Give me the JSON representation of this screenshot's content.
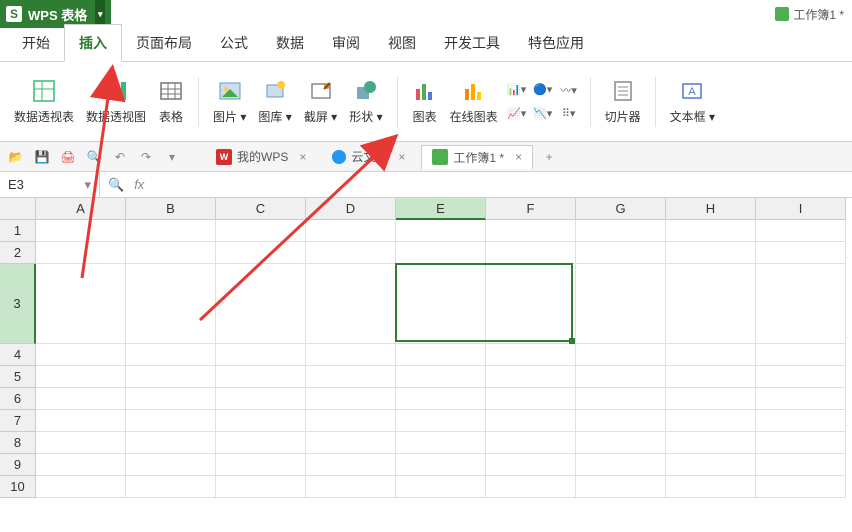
{
  "title": {
    "app": "WPS 表格",
    "doc": "工作簿1 *"
  },
  "menu": {
    "tabs": [
      "开始",
      "插入",
      "页面布局",
      "公式",
      "数据",
      "审阅",
      "视图",
      "开发工具",
      "特色应用"
    ],
    "active_index": 1
  },
  "ribbon": {
    "pivot_table": "数据透视表",
    "pivot_chart": "数据透视图",
    "table": "表格",
    "picture": "图片",
    "gallery": "图库",
    "screenshot": "截屏",
    "shape": "形状",
    "chart": "图表",
    "online_chart": "在线图表",
    "slicer": "切片器",
    "textbox": "文本框"
  },
  "doc_tabs": {
    "wps_home": "我的WPS",
    "cloud": "云文档",
    "workbook": "工作簿1 *"
  },
  "formula": {
    "namebox": "E3",
    "fx": "fx"
  },
  "grid": {
    "cols": [
      "A",
      "B",
      "C",
      "D",
      "E",
      "F",
      "G",
      "H",
      "I"
    ],
    "rows": [
      "1",
      "2",
      "3",
      "4",
      "5",
      "6",
      "7",
      "8",
      "9",
      "10"
    ],
    "selected_col": "E",
    "selected_row": "3",
    "tall_row": "3"
  }
}
